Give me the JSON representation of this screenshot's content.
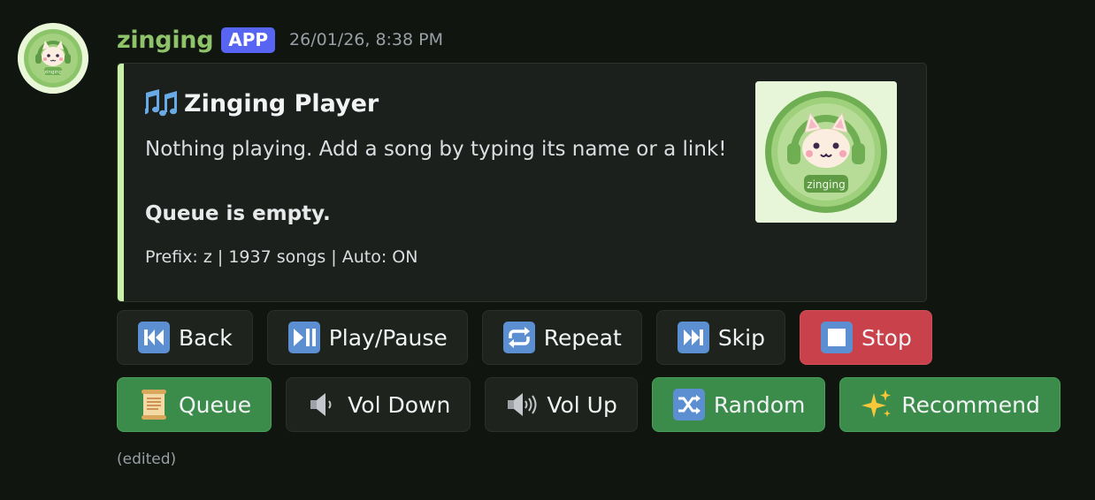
{
  "author": {
    "username": "zinging",
    "badge": "APP",
    "timestamp": "26/01/26, 8:38 PM",
    "avatar_icon": "cat-headphones-avatar-icon",
    "avatar_caption": "zinging"
  },
  "embed": {
    "accent_color": "#c9f0a8",
    "title_icon": "musical-notes-icon",
    "title": "Zinging Player",
    "description": "Nothing playing. Add a song by typing its name or a link!",
    "queue_status": "Queue is empty.",
    "footer": "Prefix: z | 1937 songs | Auto: ON",
    "thumbnail_icon": "cat-headphones-thumbnail-icon",
    "thumbnail_caption": "zinging"
  },
  "buttons_row1": [
    {
      "label": "Back",
      "icon": "rewind-icon",
      "style": "secondary"
    },
    {
      "label": "Play/Pause",
      "icon": "play-pause-icon",
      "style": "secondary"
    },
    {
      "label": "Repeat",
      "icon": "repeat-icon",
      "style": "secondary"
    },
    {
      "label": "Skip",
      "icon": "fast-forward-icon",
      "style": "secondary"
    },
    {
      "label": "Stop",
      "icon": "stop-icon",
      "style": "danger"
    }
  ],
  "buttons_row2": [
    {
      "label": "Queue",
      "icon": "scroll-icon",
      "style": "success"
    },
    {
      "label": "Vol Down",
      "icon": "speaker-low-icon",
      "style": "secondary"
    },
    {
      "label": "Vol Up",
      "icon": "speaker-high-icon",
      "style": "secondary"
    },
    {
      "label": "Random",
      "icon": "shuffle-icon",
      "style": "success"
    },
    {
      "label": "Recommend",
      "icon": "sparkles-icon",
      "style": "success"
    }
  ],
  "edited_label": "(edited)",
  "colors": {
    "username": "#8fc36a",
    "badge": "#5865f2",
    "success": "#3b8c4a",
    "danger": "#c9414a",
    "secondary": "#1e231e"
  }
}
